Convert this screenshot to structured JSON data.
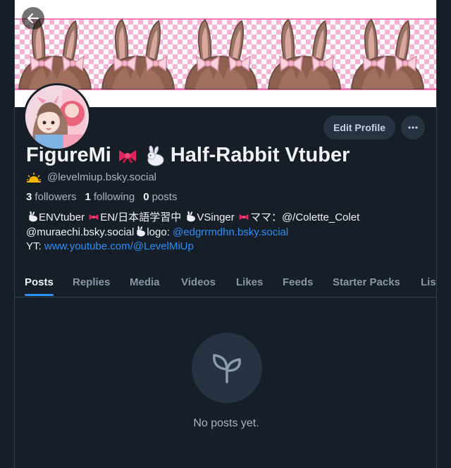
{
  "header": {
    "display_name": "FigureMi",
    "display_name_suffix": "Half-Rabbit Vtuber",
    "handle": "@levelmiup.bsky.social",
    "edit_profile_label": "Edit Profile",
    "more_label": "···"
  },
  "stats": {
    "followers_count": "3",
    "followers_label": "followers",
    "following_count": "1",
    "following_label": "following",
    "posts_count": "0",
    "posts_label": "posts"
  },
  "bio": {
    "line1_a": "ENVtuber",
    "line1_b": "EN/日本語学習中",
    "line1_c": "VSinger",
    "line1_d": "ママ：@/Colette_Colet",
    "line2_a": "@muraechi.bsky.social",
    "line2_b": "logo:",
    "line2_link": "@edgrrmdhn.bsky.social",
    "line3_prefix": "YT:",
    "line3_link": "www.youtube.com/@LevelMiUp"
  },
  "tabs": [
    {
      "label": "Posts",
      "active": true
    },
    {
      "label": "Replies",
      "active": false
    },
    {
      "label": "Media",
      "active": false
    },
    {
      "label": "Videos",
      "active": false
    },
    {
      "label": "Likes",
      "active": false
    },
    {
      "label": "Feeds",
      "active": false
    },
    {
      "label": "Starter Packs",
      "active": false
    },
    {
      "label": "Lists",
      "active": false
    }
  ],
  "empty_state": {
    "message": "No posts yet.",
    "icon": "sprout-icon"
  },
  "icons": {
    "back": "arrow-left-icon",
    "more": "ellipsis-icon",
    "handle_badge": "sunrise-icon",
    "ribbon": "ribbon-icon",
    "rabbit": "rabbit-icon"
  },
  "colors": {
    "background": "#161e27",
    "accent": "#2a8ff7",
    "muted_text": "#a8b4c0",
    "banner_pink": "#f6b3d4",
    "ribbon_red": "#e0245e"
  }
}
